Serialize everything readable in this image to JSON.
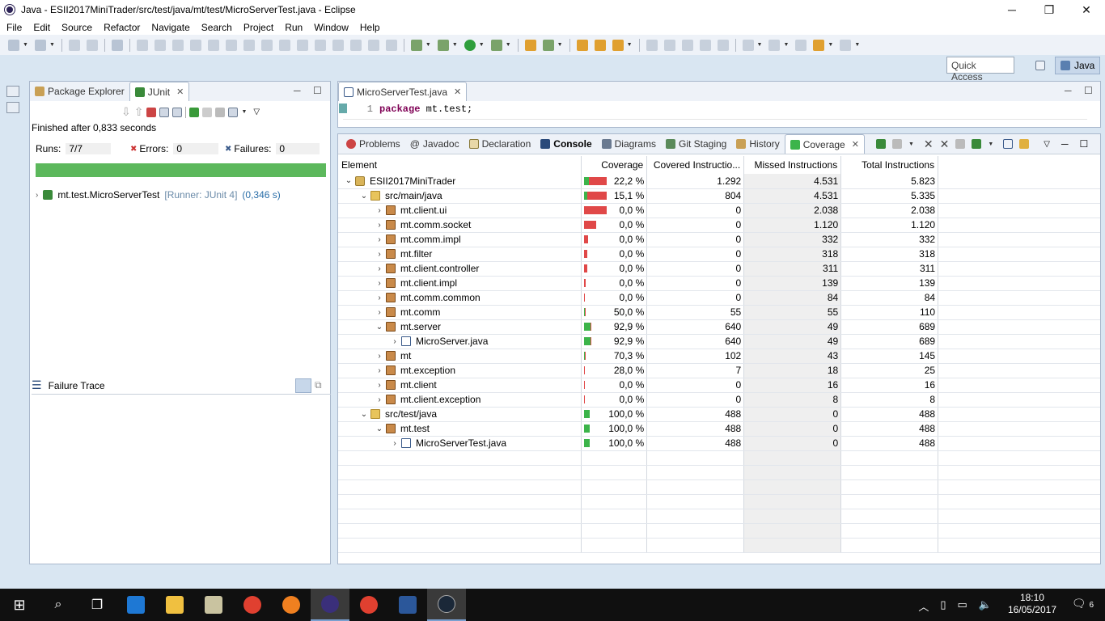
{
  "window": {
    "title": "Java - ESII2017MiniTrader/src/test/java/mt/test/MicroServerTest.java - Eclipse",
    "minimize": "─",
    "restore": "❐",
    "close": "✕"
  },
  "menu": [
    "File",
    "Edit",
    "Source",
    "Refactor",
    "Navigate",
    "Search",
    "Project",
    "Run",
    "Window",
    "Help"
  ],
  "quick_access": {
    "placeholder": "Quick Access"
  },
  "perspective": {
    "label": "Java"
  },
  "left_panel": {
    "tabs": [
      {
        "label": "Package Explorer"
      },
      {
        "label": "JUnit"
      }
    ],
    "finished": "Finished after 0,833 seconds",
    "runs_label": "Runs:",
    "runs_value": "7/7",
    "errors_label": "Errors:",
    "errors_value": "0",
    "failures_label": "Failures:",
    "failures_value": "0",
    "progress_fraction": 1.0,
    "test": {
      "name": "mt.test.MicroServerTest",
      "runner": "[Runner: JUnit 4]",
      "time": "(0,346 s)"
    },
    "failure_trace": "Failure Trace"
  },
  "editor": {
    "tab": "MicroServerTest.java",
    "line_number": "1",
    "keyword": "package",
    "code": "mt.test;"
  },
  "bottom_panel": {
    "tabs": [
      {
        "label": "Problems"
      },
      {
        "label": "Javadoc",
        "prefix": "@"
      },
      {
        "label": "Declaration"
      },
      {
        "label": "Console"
      },
      {
        "label": "Diagrams"
      },
      {
        "label": "Git Staging"
      },
      {
        "label": "History"
      },
      {
        "label": "Coverage"
      }
    ],
    "columns": [
      "Element",
      "Coverage",
      "Covered Instructio...",
      "Missed Instructions",
      "Total Instructions"
    ],
    "rows": [
      {
        "name": "ESII2017MiniTrader",
        "level": 0,
        "expanded": true,
        "icon": "project",
        "coverage": "22,2 %",
        "pct": 22.2,
        "covered": "1.292",
        "missed": "4.531",
        "total": "5.823"
      },
      {
        "name": "src/main/java",
        "level": 1,
        "expanded": true,
        "icon": "folder",
        "coverage": "15,1 %",
        "pct": 15.1,
        "covered": "804",
        "missed": "4.531",
        "total": "5.335"
      },
      {
        "name": "mt.client.ui",
        "level": 2,
        "expanded": false,
        "icon": "pkg",
        "coverage": "0,0 %",
        "pct": 0,
        "covered": "0",
        "missed": "2.038",
        "total": "2.038"
      },
      {
        "name": "mt.comm.socket",
        "level": 2,
        "expanded": false,
        "icon": "pkg",
        "coverage": "0,0 %",
        "pct": 0,
        "covered": "0",
        "missed": "1.120",
        "total": "1.120"
      },
      {
        "name": "mt.comm.impl",
        "level": 2,
        "expanded": false,
        "icon": "pkg",
        "coverage": "0,0 %",
        "pct": 0,
        "covered": "0",
        "missed": "332",
        "total": "332"
      },
      {
        "name": "mt.filter",
        "level": 2,
        "expanded": false,
        "icon": "pkg",
        "coverage": "0,0 %",
        "pct": 0,
        "covered": "0",
        "missed": "318",
        "total": "318"
      },
      {
        "name": "mt.client.controller",
        "level": 2,
        "expanded": false,
        "icon": "pkg",
        "coverage": "0,0 %",
        "pct": 0,
        "covered": "0",
        "missed": "311",
        "total": "311"
      },
      {
        "name": "mt.client.impl",
        "level": 2,
        "expanded": false,
        "icon": "pkg",
        "coverage": "0,0 %",
        "pct": 0,
        "covered": "0",
        "missed": "139",
        "total": "139"
      },
      {
        "name": "mt.comm.common",
        "level": 2,
        "expanded": false,
        "icon": "pkg",
        "coverage": "0,0 %",
        "pct": 0,
        "covered": "0",
        "missed": "84",
        "total": "84"
      },
      {
        "name": "mt.comm",
        "level": 2,
        "expanded": false,
        "icon": "pkg",
        "coverage": "50,0 %",
        "pct": 50,
        "covered": "55",
        "missed": "55",
        "total": "110"
      },
      {
        "name": "mt.server",
        "level": 2,
        "expanded": true,
        "icon": "pkg",
        "coverage": "92,9 %",
        "pct": 92.9,
        "covered": "640",
        "missed": "49",
        "total": "689"
      },
      {
        "name": "MicroServer.java",
        "level": 3,
        "expanded": false,
        "icon": "file",
        "coverage": "92,9 %",
        "pct": 92.9,
        "covered": "640",
        "missed": "49",
        "total": "689"
      },
      {
        "name": "mt",
        "level": 2,
        "expanded": false,
        "icon": "pkg",
        "coverage": "70,3 %",
        "pct": 70.3,
        "covered": "102",
        "missed": "43",
        "total": "145"
      },
      {
        "name": "mt.exception",
        "level": 2,
        "expanded": false,
        "icon": "pkg",
        "coverage": "28,0 %",
        "pct": 28,
        "covered": "7",
        "missed": "18",
        "total": "25"
      },
      {
        "name": "mt.client",
        "level": 2,
        "expanded": false,
        "icon": "pkg",
        "coverage": "0,0 %",
        "pct": 0,
        "covered": "0",
        "missed": "16",
        "total": "16"
      },
      {
        "name": "mt.client.exception",
        "level": 2,
        "expanded": false,
        "icon": "pkg",
        "coverage": "0,0 %",
        "pct": 0,
        "covered": "0",
        "missed": "8",
        "total": "8"
      },
      {
        "name": "src/test/java",
        "level": 1,
        "expanded": true,
        "icon": "folder",
        "coverage": "100,0 %",
        "pct": 100,
        "covered": "488",
        "missed": "0",
        "total": "488"
      },
      {
        "name": "mt.test",
        "level": 2,
        "expanded": true,
        "icon": "pkg",
        "coverage": "100,0 %",
        "pct": 100,
        "covered": "488",
        "missed": "0",
        "total": "488"
      },
      {
        "name": "MicroServerTest.java",
        "level": 3,
        "expanded": false,
        "icon": "file",
        "coverage": "100,0 %",
        "pct": 100,
        "covered": "488",
        "missed": "0",
        "total": "488"
      }
    ]
  },
  "taskbar": {
    "time": "18:10",
    "date": "16/05/2017",
    "notifications": "6",
    "colors": {
      "edge": "#1e78d4",
      "explorer": "#f0c040",
      "chrome": "#e04030",
      "firefox": "#f08020",
      "eclipse": "#3a2f7a",
      "word": "#2b579a",
      "steam": "#1b2838"
    }
  },
  "colors": {
    "covered": "#3cb44a",
    "missed": "#e04848",
    "progress": "#5cb85c"
  }
}
